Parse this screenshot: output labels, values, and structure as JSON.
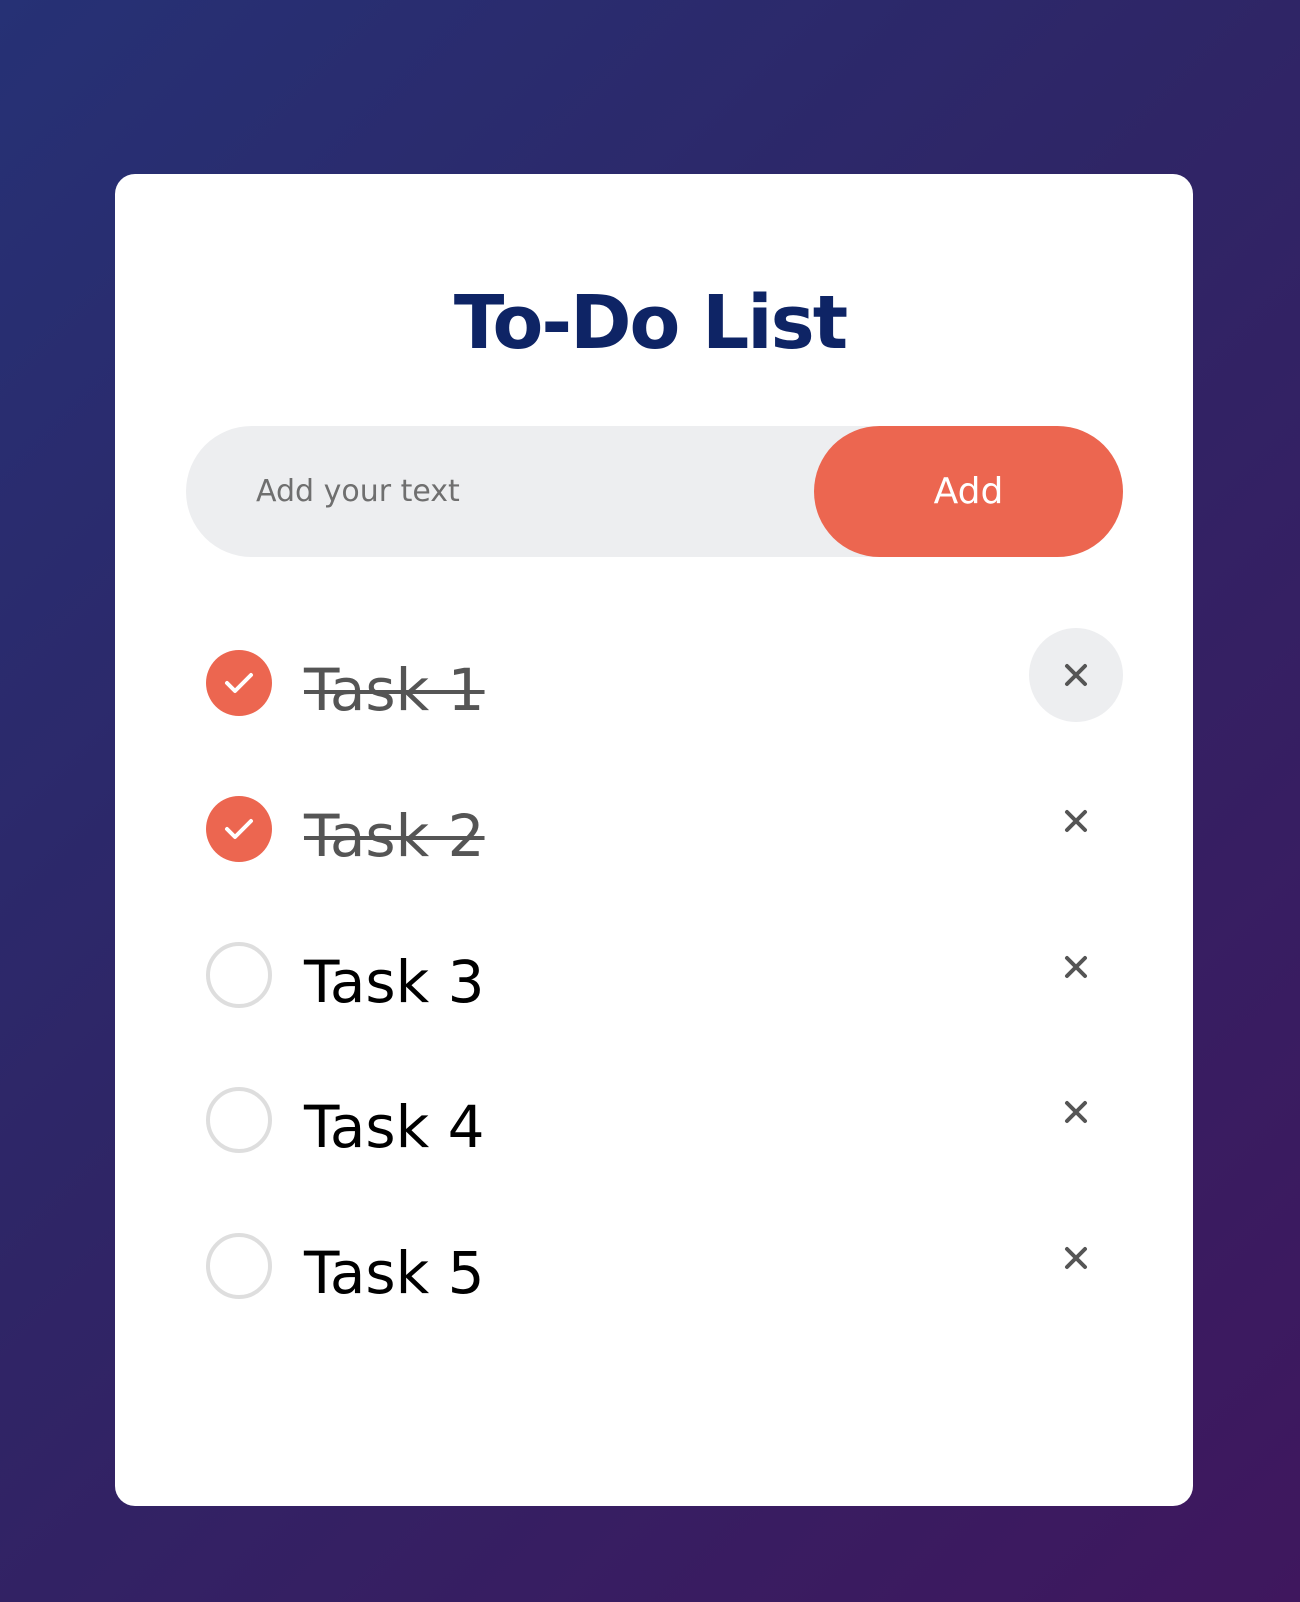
{
  "app": {
    "title": "To-Do List"
  },
  "input": {
    "placeholder": "Add your text",
    "value": ""
  },
  "add_button": {
    "label": "Add"
  },
  "tasks": [
    {
      "label": "Task 1",
      "checked": true
    },
    {
      "label": "Task 2",
      "checked": true
    },
    {
      "label": "Task 3",
      "checked": false
    },
    {
      "label": "Task 4",
      "checked": false
    },
    {
      "label": "Task 5",
      "checked": false
    }
  ],
  "icons": {
    "check": "check-icon",
    "delete": "close-icon"
  },
  "colors": {
    "accent": "#ec6650",
    "title": "#0e2465",
    "input_background": "#edeef0",
    "background_start": "#263175",
    "background_end": "#3f175e"
  }
}
